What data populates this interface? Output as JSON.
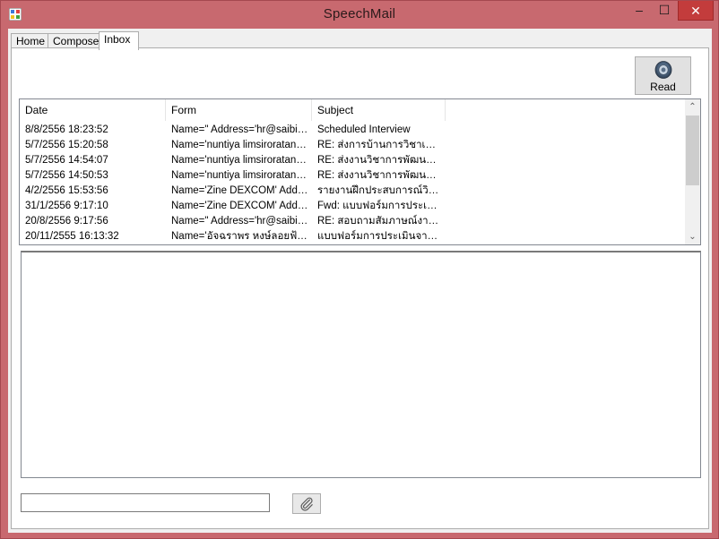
{
  "window": {
    "title": "SpeechMail",
    "minimize_glyph": "–",
    "maximize_glyph": "☐",
    "close_glyph": "✕"
  },
  "tabs": [
    {
      "label": "Home",
      "selected": false
    },
    {
      "label": "Compose",
      "selected": false
    },
    {
      "label": "Inbox",
      "selected": true
    }
  ],
  "read_button": {
    "label": "Read",
    "icon": "speaker-icon"
  },
  "inbox": {
    "columns": [
      "Date",
      "Form",
      "Subject"
    ],
    "rows": [
      {
        "date": "8/8/2556 18:23:52",
        "from": "Name=\" Address='hr@saibizs...",
        "subject": "Scheduled Interview"
      },
      {
        "date": "5/7/2556 15:20:58",
        "from": "Name='nuntiya limsiroratana' ...",
        "subject": "RE: ส่งการบ้านการวิชาเขีย..."
      },
      {
        "date": "5/7/2556 14:54:07",
        "from": "Name='nuntiya limsiroratana' ...",
        "subject": "RE: ส่งงานวิชาการพัฒนาร..."
      },
      {
        "date": "5/7/2556 14:50:53",
        "from": "Name='nuntiya limsiroratana' ...",
        "subject": "RE: ส่งงานวิชาการพัฒนาร..."
      },
      {
        "date": "4/2/2556 15:53:56",
        "from": "Name='Zine DEXCOM' Addre...",
        "subject": "รายงานฝึกประสบการณ์วิชา..."
      },
      {
        "date": "31/1/2556 9:17:10",
        "from": "Name='Zine DEXCOM' Addre...",
        "subject": "Fwd: แบบฟอร์มการประเมิ..."
      },
      {
        "date": "20/8/2556 9:17:56",
        "from": "Name=\" Address='hr@saibizs...",
        "subject": "RE: สอบถามสัมภาษณ์งานค..."
      },
      {
        "date": "20/11/2555 16:13:32",
        "from": "Name='อัจฉราพร หงษ์ลอยฟ้า' ...",
        "subject": "แบบฟอร์มการประเมินจาก..."
      }
    ]
  },
  "message_body": "",
  "attachment": {
    "path": "",
    "button_icon": "paperclip-icon"
  },
  "scrollbar": {
    "up_glyph": "⌃",
    "down_glyph": "⌄"
  }
}
